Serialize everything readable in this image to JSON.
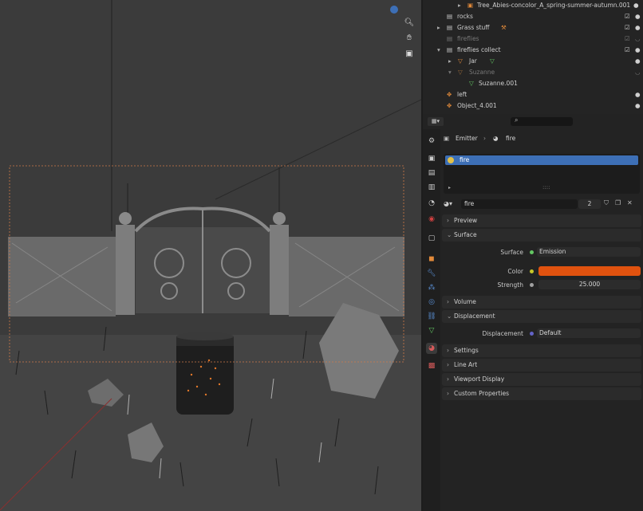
{
  "outliner": {
    "rows": [
      {
        "label": "Tree_Abies-concolor_A_spring-summer-autumn.001"
      },
      {
        "label": "rocks"
      },
      {
        "label": "Grass stuff"
      },
      {
        "label": "fireflies"
      },
      {
        "label": "fireflies collect"
      },
      {
        "label": "Jar"
      },
      {
        "label": "Suzanne"
      },
      {
        "label": "Suzanne.001"
      },
      {
        "label": "left"
      },
      {
        "label": "Object_4.001"
      }
    ]
  },
  "breadcrumb": {
    "object": "Emitter",
    "material": "fire"
  },
  "material_slot": {
    "name": "fire",
    "dots": "::::"
  },
  "material": {
    "name": "fire",
    "users": "2"
  },
  "sections": {
    "preview": "Preview",
    "surface": "Surface",
    "volume": "Volume",
    "displacement": "Displacement",
    "settings": "Settings",
    "line_art": "Line Art",
    "viewport_display": "Viewport Display",
    "custom_properties": "Custom Properties"
  },
  "surface": {
    "surface_label": "Surface",
    "surface_value": "Emission",
    "color_label": "Color",
    "color_value": "#e0520f",
    "strength_label": "Strength",
    "strength_value": "25.000"
  },
  "displacement": {
    "label": "Displacement",
    "value": "Default"
  },
  "colors": {
    "accent": "#3d6fb6",
    "emission": "#e0520f",
    "socket_green": "#63c763",
    "socket_yellow": "#c7c729",
    "socket_purple": "#6363c7"
  }
}
